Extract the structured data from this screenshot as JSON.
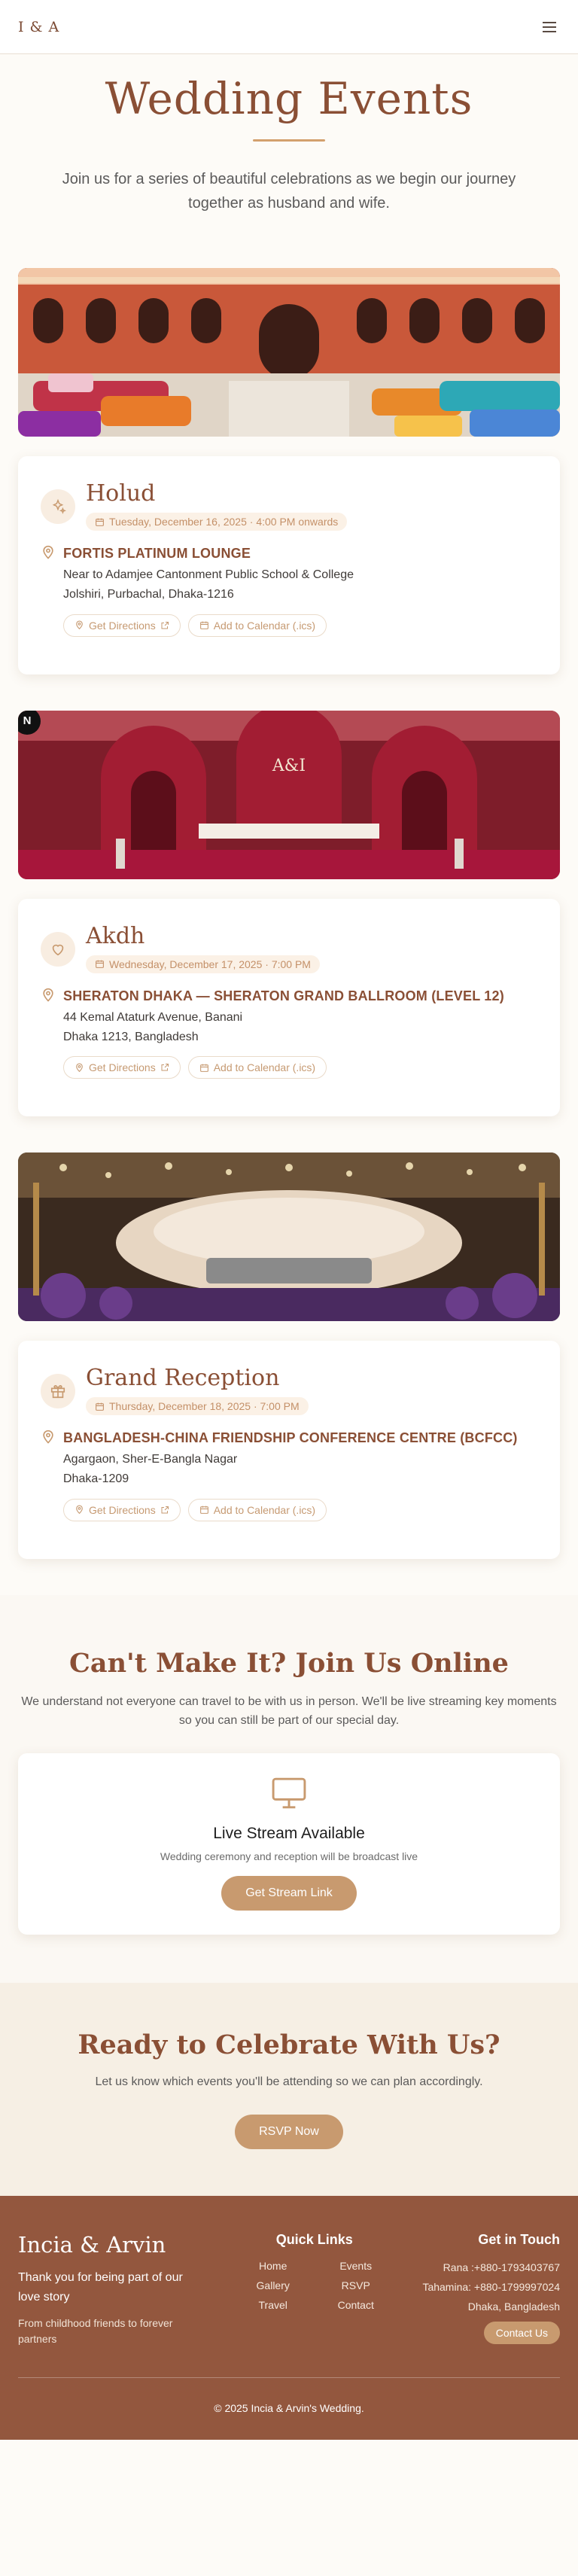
{
  "header": {
    "logo": "I & A",
    "menu_icon": "hamburger-menu-icon"
  },
  "hero": {
    "title": "Wedding Events",
    "subtitle": "Join us for a series of beautiful celebrations as we begin our journey together as husband and wife."
  },
  "events": [
    {
      "icon": "sparkles-icon",
      "title": "Holud",
      "date": "Tuesday, December 16, 2025 · 4:00 PM onwards",
      "venue": "FORTIS PLATINUM LOUNGE",
      "address_line1": "Near to Adamjee Cantonment Public School & College",
      "address_line2": "Jolshiri, Purbachal, Dhaka-1216",
      "directions_label": "Get Directions",
      "calendar_label": "Add to Calendar (.ics)"
    },
    {
      "icon": "heart-icon",
      "title": "Akdh",
      "date": "Wednesday, December 17, 2025 · 7:00 PM",
      "venue": "SHERATON DHAKA — SHERATON GRAND BALLROOM (LEVEL 12)",
      "address_line1": "44 Kemal Ataturk Avenue, Banani",
      "address_line2": "Dhaka 1213, Bangladesh",
      "directions_label": "Get Directions",
      "calendar_label": "Add to Calendar (.ics)"
    },
    {
      "icon": "gift-icon",
      "title": "Grand Reception",
      "date": "Thursday, December 18, 2025 · 7:00 PM",
      "venue": "BANGLADESH-CHINA FRIENDSHIP CONFERENCE CENTRE (BCFCC)",
      "address_line1": "Agargaon, Sher-E-Bangla Nagar",
      "address_line2": "Dhaka-1209",
      "directions_label": "Get Directions",
      "calendar_label": "Add to Calendar (.ics)"
    }
  ],
  "badge": {
    "label": "N"
  },
  "online": {
    "title": "Can't Make It? Join Us Online",
    "description": "We understand not everyone can travel to be with us in person. We'll be live streaming key moments so you can still be part of our special day.",
    "card_title": "Live Stream Available",
    "card_sub": "Wedding ceremony and reception will be broadcast live",
    "button": "Get Stream Link"
  },
  "rsvp": {
    "title": "Ready to Celebrate With Us?",
    "text": "Let us know which events you'll be attending so we can plan accordingly.",
    "button": "RSVP Now"
  },
  "footer": {
    "brand": "Incia & Arvin",
    "tagline": "Thank you for being part of our love story",
    "small": "From childhood friends to forever partners",
    "links_title": "Quick Links",
    "links": [
      "Home",
      "Events",
      "Gallery",
      "RSVP",
      "Travel",
      "Contact"
    ],
    "contact_title": "Get in Touch",
    "contact_lines": [
      "Rana :+880-1793403767",
      "Tahamina: +880-1799997024",
      "Dhaka, Bangladesh"
    ],
    "contact_button": "Contact Us",
    "copyright": "© 2025 Incia & Arvin's Wedding."
  },
  "colors": {
    "accent": "#8a4f35",
    "gold": "#c89a6f",
    "footer_bg": "#93573e"
  }
}
